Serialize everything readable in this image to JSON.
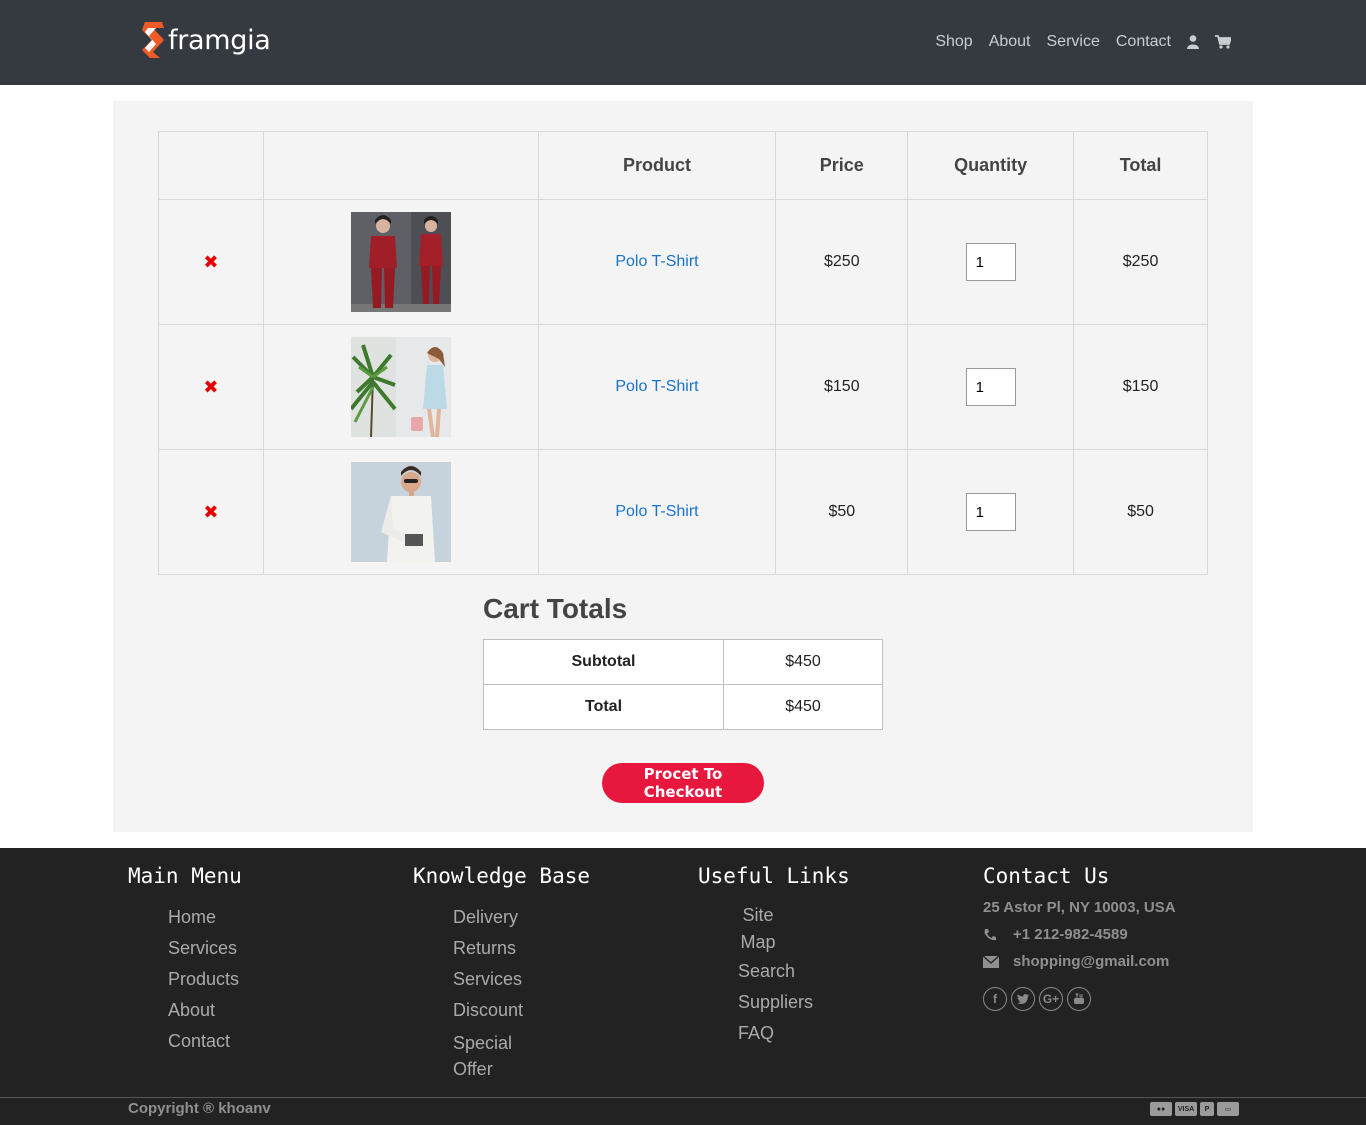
{
  "brand": {
    "name": "framgia"
  },
  "nav": {
    "links": [
      "Shop",
      "About",
      "Service",
      "Contact"
    ],
    "user_icon": "user-icon",
    "cart_icon": "cart-icon"
  },
  "cart": {
    "headers": [
      "",
      "",
      "Product",
      "Price",
      "Quantity",
      "Total"
    ],
    "rows": [
      {
        "remove": "✖",
        "image": "woman-red-tracksuit",
        "product": "Polo T-Shirt",
        "price": "$250",
        "quantity": "1",
        "total": "$250"
      },
      {
        "remove": "✖",
        "image": "woman-blue-dress",
        "product": "Polo T-Shirt",
        "price": "$150",
        "quantity": "1",
        "total": "$150"
      },
      {
        "remove": "✖",
        "image": "man-white-shirt",
        "product": "Polo T-Shirt",
        "price": "$50",
        "quantity": "1",
        "total": "$50"
      }
    ]
  },
  "totals": {
    "title": "Cart Totals",
    "subtotal_label": "Subtotal",
    "subtotal_value": "$450",
    "total_label": "Total",
    "total_value": "$450",
    "checkout_label": "Procet To Checkout"
  },
  "footer": {
    "main_menu": {
      "title": "Main Menu",
      "items": [
        "Home",
        "Services",
        "Products",
        "About",
        "Contact"
      ]
    },
    "knowledge_base": {
      "title": "Knowledge Base",
      "items": [
        "Delivery",
        "Returns",
        "Services",
        "Discount",
        "Special Offer"
      ]
    },
    "useful_links": {
      "title": "Useful Links",
      "items": [
        "Site Map",
        "Search",
        "Suppliers",
        "FAQ"
      ]
    },
    "contact": {
      "title": "Contact Us",
      "address": "25 Astor Pl, NY 10003, USA",
      "phone": "+1 212-982-4589",
      "email": "shopping@gmail.com",
      "socials": [
        "facebook-icon",
        "twitter-icon",
        "google-plus-icon",
        "youtube-icon"
      ]
    },
    "copyright": "Copyright ® khoanv",
    "payments": [
      "mastercard-icon",
      "visa-icon",
      "paypal-icon",
      "card-icon"
    ]
  },
  "colors": {
    "header_bg": "#343a40",
    "panel_bg": "#f4f4f4",
    "link": "#1a73c9",
    "remove": "#e60000",
    "checkout": "#e8173e",
    "footer_bg": "#222222"
  }
}
